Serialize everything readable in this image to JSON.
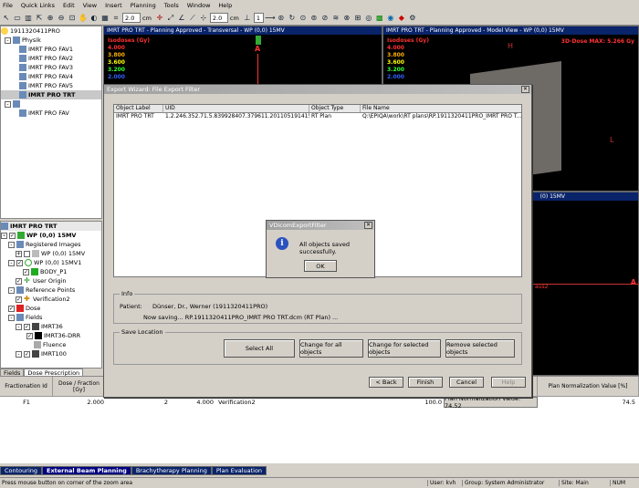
{
  "menu": [
    "File",
    "Quick Links",
    "Edit",
    "View",
    "Insert",
    "Planning",
    "Tools",
    "Window",
    "Help"
  ],
  "toolbar": {
    "zoom1": "2.0",
    "unit1": "cm",
    "zoom2": "2.0",
    "unit2": "cm",
    "field3": "1"
  },
  "tree": {
    "root": "1911320411PRO",
    "group1": "Physik",
    "items1": [
      "IMRT PRO FAV1",
      "IMRT PRO FAV2",
      "IMRT PRO FAV3",
      "IMRT PRO FAV4",
      "IMRT PRO FAV5",
      "IMRT PRO TRT"
    ],
    "group2": "",
    "items2": [
      "IMRT PRO FAV"
    ]
  },
  "tree2": {
    "title": "IMRT PRO TRT",
    "rows": [
      "WP (0,0) 15MV",
      "Registered Images",
      "WP (0,0) 15MV",
      "WP (0,0) 15MV1",
      "BODY_P1",
      "User Origin",
      "Reference Points",
      "Verification2",
      "Dose",
      "Fields",
      "IMRT36",
      "IMRT36-DRR",
      "Fluence",
      "IMRT100"
    ]
  },
  "views": {
    "left_title": "IMRT PRO TRT - Planning Approved - Transversal - WP (0,0) 15MV",
    "right_title": "IMRT PRO TRT - Planning Approved - Model View - WP (0,0) 15MV",
    "lower_title": "(0) 15MV",
    "iso_label": "Isodoses (Gy)",
    "iso_levels": [
      "4.000",
      "3.800",
      "3.600",
      "3.200",
      "2.000"
    ],
    "iso_colors": [
      "#ff3030",
      "#ffb000",
      "#ffff00",
      "#30ff30",
      "#3060ff"
    ],
    "dose_max": "3D-Dose MAX: 5.266 Gy",
    "label_A": "A",
    "label_H": "H",
    "label_L": "L",
    "label_P": "P",
    "right_snip": "aus2"
  },
  "left_tabs": [
    "Fields",
    "Dose Prescription"
  ],
  "grid": {
    "headers": [
      "Fractionation Id",
      "Dose / Fraction [Gy]",
      "",
      "",
      "",
      "",
      "",
      "Plan Normalization Value [%]"
    ],
    "row": [
      "F1",
      "2.000",
      "2",
      "4.000",
      "Verification2",
      "100.0",
      "Plan Normalization Value: 74.52",
      "74.5"
    ]
  },
  "bottom_tabs": [
    "Contouring",
    "External Beam Planning",
    "Brachytherapy Planning",
    "Plan Evaluation"
  ],
  "status": {
    "hint": "Press mouse button on corner of the zoom area",
    "user": "User: kvh",
    "group": "Group: System Administrator",
    "site": "Site: Main",
    "num": "NUM"
  },
  "dialog": {
    "title": "Export Wizard: File Export Filter",
    "columns": [
      "Object Label",
      "UID",
      "Object Type",
      "File Name"
    ],
    "row": [
      "IMRT PRO TRT",
      "1.2.246.352.71.5.839928407.379611.20110519141528",
      "RT Plan",
      "Q:\\EPIQA\\work\\RT plans\\RP.1911320411PRO_IMRT PRO T..."
    ],
    "info_label": "Info",
    "patient_label": "Patient:",
    "patient_value": "Dünser, Dr., Werner (1911320411PRO)",
    "saving": "Now saving... RP.1911320411PRO_IMRT PRO TRT.dcm (RT Plan) ...",
    "save_location": "Save Location",
    "buttons": [
      "Select All",
      "Change for all objects",
      "Change for selected objects",
      "Remove selected objects"
    ],
    "nav": [
      "< Back",
      "Finish",
      "Cancel",
      "Help"
    ]
  },
  "message": {
    "title": "VDicomExportFilter",
    "text": "All objects saved successfully.",
    "ok": "OK"
  }
}
